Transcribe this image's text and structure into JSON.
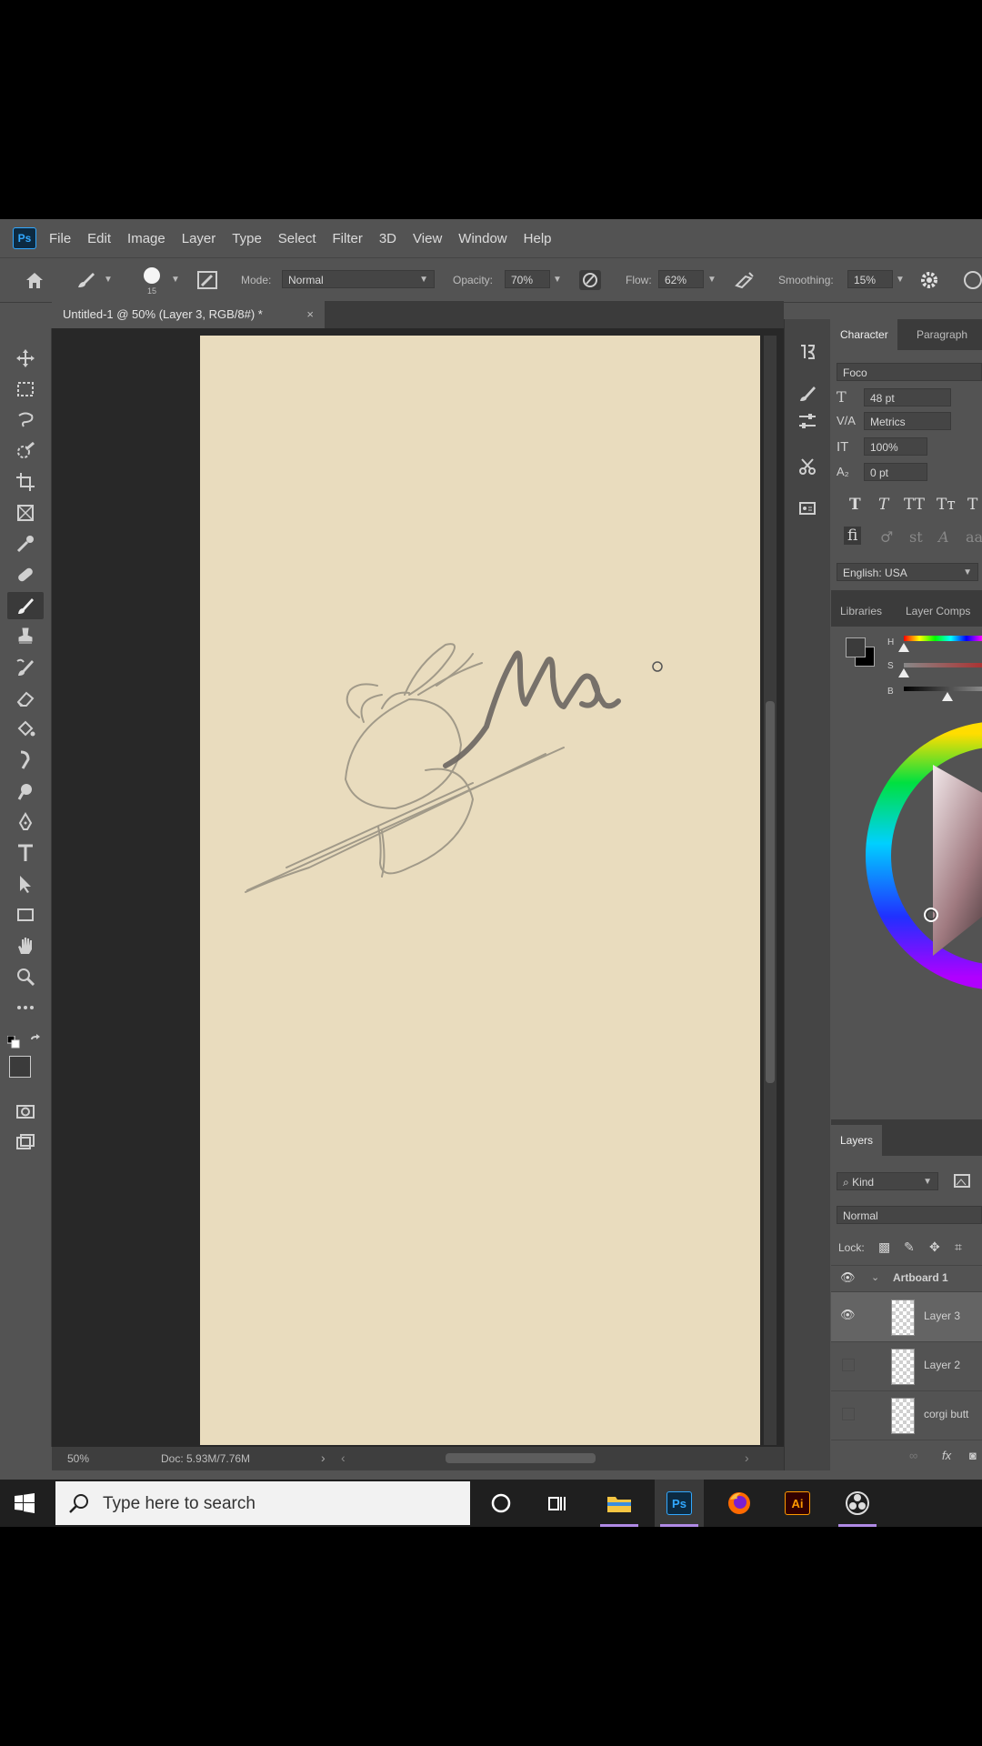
{
  "menu": {
    "logo": "Ps",
    "items": [
      "File",
      "Edit",
      "Image",
      "Layer",
      "Type",
      "Select",
      "Filter",
      "3D",
      "View",
      "Window",
      "Help"
    ]
  },
  "options": {
    "brush_size": "15",
    "mode_label": "Mode:",
    "mode_value": "Normal",
    "opacity_label": "Opacity:",
    "opacity_value": "70%",
    "flow_label": "Flow:",
    "flow_value": "62%",
    "smoothing_label": "Smoothing:",
    "smoothing_value": "15%"
  },
  "document": {
    "tab_title": "Untitled-1 @ 50% (Layer 3, RGB/8#) *",
    "tab_close": "×",
    "zoom": "50%",
    "doc_info": "Doc: 5.93M/7.76M"
  },
  "character_panel": {
    "tabs": [
      "Character",
      "Paragraph"
    ],
    "font": "Foco",
    "size": "48 pt",
    "kerning": "Metrics",
    "vscale": "100%",
    "baseline": "0 pt",
    "language": "English: USA"
  },
  "color_panel": {
    "tabs": [
      "Libraries",
      "Layer Comps"
    ],
    "h_label": "H",
    "s_label": "S",
    "b_label": "B"
  },
  "layers_panel": {
    "title": "Layers",
    "filter": "Kind",
    "blend": "Normal",
    "lock_label": "Lock:",
    "artboard": "Artboard 1",
    "layers": [
      "Layer 3",
      "Layer 2",
      "corgi butt"
    ]
  },
  "taskbar": {
    "search_placeholder": "Type here to search"
  },
  "colors": {
    "ui_bg": "#535353",
    "canvas": "#e9dcbe",
    "accent": "#31a8ff"
  }
}
